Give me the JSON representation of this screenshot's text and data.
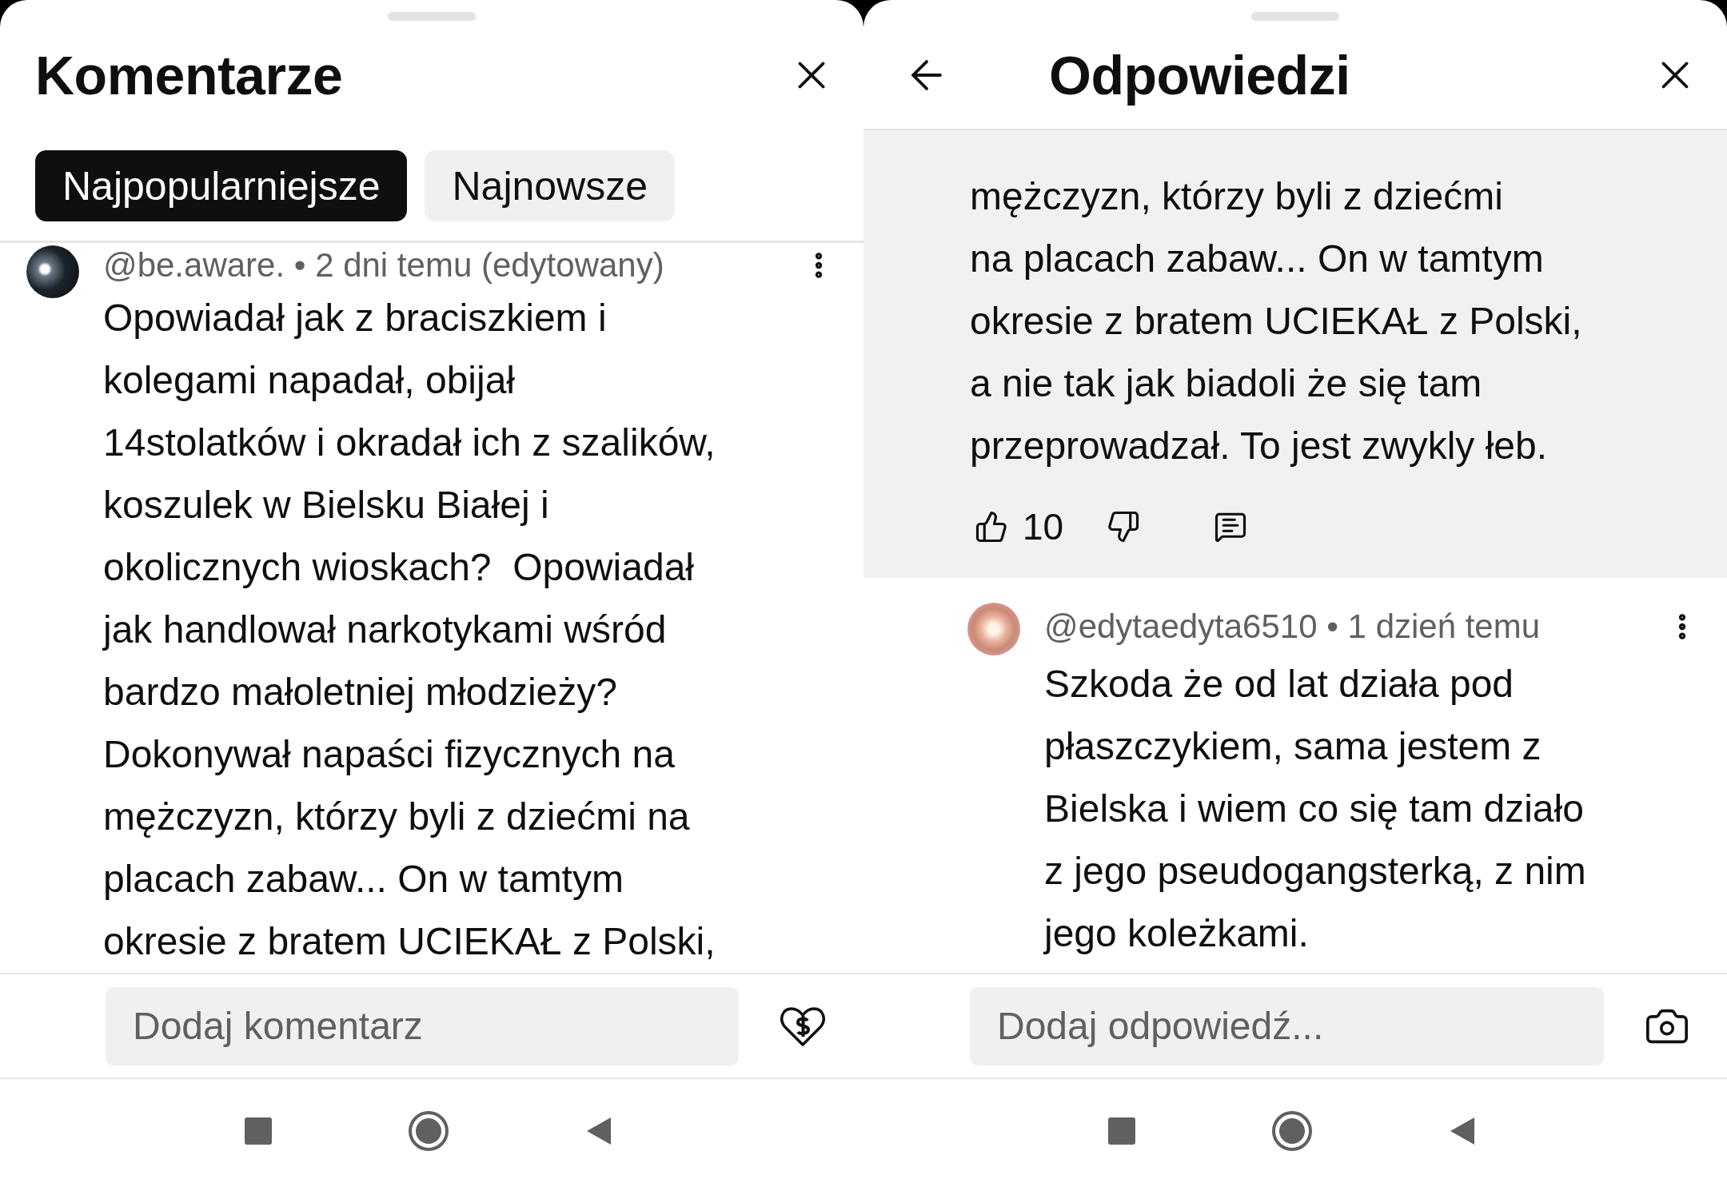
{
  "left_panel": {
    "title": "Komentarze",
    "tabs": [
      {
        "label": "Najpopularniejsze",
        "selected": true
      },
      {
        "label": "Najnowsze",
        "selected": false
      }
    ],
    "comment": {
      "author": "@be.aware.",
      "meta": "• 2 dni temu (edytowany)",
      "lines": [
        "Opowiadał jak z braciszkiem i",
        "kolegami napadał, obijał",
        "14stolatków i okradał ich z szalików,",
        "koszulek w Bielsku Białej i",
        "okolicznych wioskach?  Opowiadał",
        "jak handlował narkotykami wśród",
        "bardzo małoletniej młodzieży?",
        "Dokonywał napaści fizycznych na",
        "mężczyzn, którzy byli z dziećmi na",
        "placach zabaw... On w tamtym",
        "okresie z bratem UCIEKAŁ z Polski,"
      ]
    },
    "composer": {
      "placeholder": "Dodaj komentarz"
    }
  },
  "right_panel": {
    "title": "Odpowiedzi",
    "parent_comment": {
      "lines": [
        "mężczyzn, którzy byli z dziećmi",
        "na placach zabaw... On w tamtym",
        "okresie z bratem UCIEKAŁ z Polski,",
        "a nie tak jak biadoli że się tam",
        "przeprowadzał. To jest zwykly łeb."
      ],
      "likes": "10"
    },
    "reply": {
      "author": "@edytaedyta6510",
      "meta": "• 1 dzień temu",
      "lines": [
        "Szkoda że od lat działa pod",
        "płaszczykiem, sama jestem z",
        "Bielska i wiem co się tam działo",
        "z jego pseudogangsterką, z nim",
        "jego koleżkami."
      ]
    },
    "composer": {
      "placeholder": "Dodaj odpowiedź..."
    }
  }
}
